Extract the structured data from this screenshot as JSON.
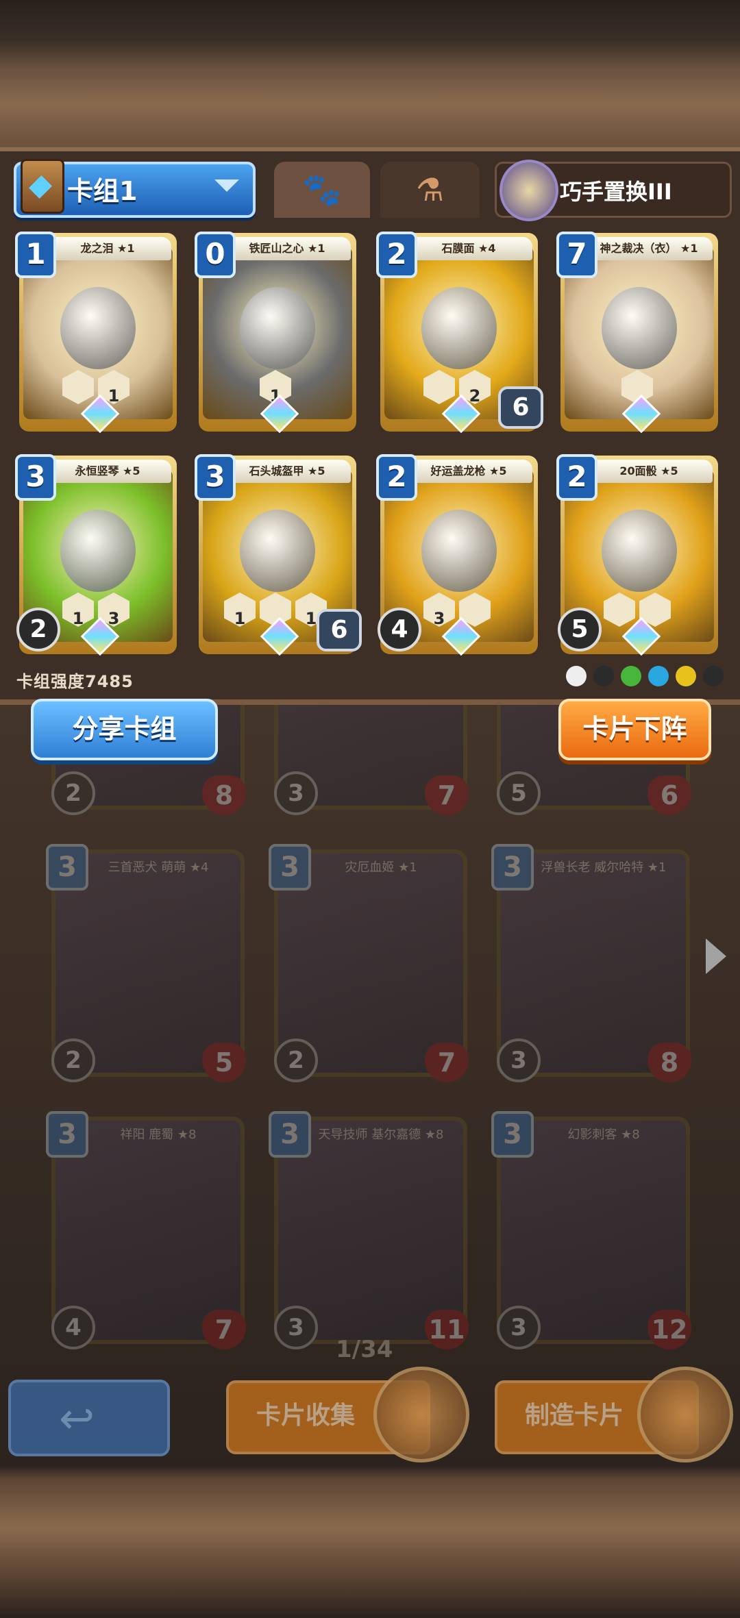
{
  "header": {
    "deck_name": "卡组1",
    "skill_label": "巧手置换III"
  },
  "tabs": [
    {
      "icon": "paw-icon"
    },
    {
      "icon": "potion-icon"
    }
  ],
  "deck_cards": [
    {
      "name": "龙之泪 ★1",
      "cost": "1",
      "stats": [
        "",
        "1"
      ],
      "hp": "",
      "atk": "",
      "color": "#d8c09a"
    },
    {
      "name": "铁匠山之心 ★1",
      "cost": "0",
      "stats": [
        "1"
      ],
      "hp": "",
      "atk": "",
      "color": "#6b6b6b"
    },
    {
      "name": "石膜面 ★4",
      "cost": "2",
      "stats": [
        "",
        "2"
      ],
      "hp": "6",
      "atk": "",
      "color": "#e2a91a"
    },
    {
      "name": "神之裁决（衣） ★1",
      "cost": "7",
      "stats": [
        ""
      ],
      "hp": "",
      "atk": "",
      "color": "#dcc29e"
    },
    {
      "name": "永恒竖琴 ★5",
      "cost": "3",
      "stats": [
        "1",
        "3"
      ],
      "hp": "",
      "atk": "2",
      "color": "#7cbf2a"
    },
    {
      "name": "石头城盔甲 ★5",
      "cost": "3",
      "stats": [
        "1",
        "",
        "1"
      ],
      "hp": "6",
      "atk": "",
      "color": "#d9a518"
    },
    {
      "name": "好运盖龙枪 ★5",
      "cost": "2",
      "stats": [
        "3",
        ""
      ],
      "hp": "",
      "atk": "4",
      "color": "#e0a11a"
    },
    {
      "name": "20面骰 ★5",
      "cost": "2",
      "stats": [
        "",
        ""
      ],
      "hp": "",
      "atk": "5",
      "color": "#e0a11a"
    }
  ],
  "deck_power": "卡组强度7485",
  "buttons": {
    "share": "分享卡组",
    "remove": "卡片下阵",
    "collection": "卡片收集",
    "craft": "制造卡片"
  },
  "collection_cards": [
    {
      "name": "",
      "cost": "",
      "atk": "2",
      "hp": "8"
    },
    {
      "name": "",
      "cost": "",
      "atk": "3",
      "hp": "7"
    },
    {
      "name": "",
      "cost": "",
      "atk": "5",
      "hp": "6"
    },
    {
      "name": "三首恶犬 萌萌 ★4",
      "cost": "3",
      "atk": "2",
      "hp": "5"
    },
    {
      "name": "灾厄血姬 ★1",
      "cost": "3",
      "atk": "2",
      "hp": "7"
    },
    {
      "name": "浮兽长老 威尔哈特 ★1",
      "cost": "3",
      "atk": "3",
      "hp": "8"
    },
    {
      "name": "祥阳 鹿蜀 ★8",
      "cost": "3",
      "atk": "4",
      "hp": "7"
    },
    {
      "name": "天导技师 基尔嘉德 ★8",
      "cost": "3",
      "atk": "3",
      "hp": "11"
    },
    {
      "name": "幻影刺客 ★8",
      "cost": "3",
      "atk": "3",
      "hp": "12"
    }
  ],
  "page_indicator": "1/34",
  "colors": {
    "primary_blue": "#2f7fd6",
    "accent_orange": "#ea6a10",
    "panel_brown": "#3d2e26"
  }
}
